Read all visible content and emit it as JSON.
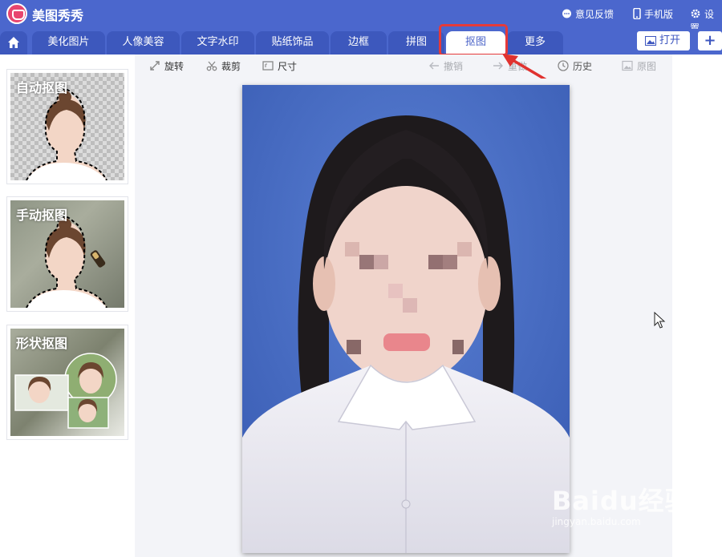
{
  "app": {
    "name": "美图秀秀"
  },
  "titlebar": {
    "feedback": "意见反馈",
    "mobile": "手机版",
    "settings": "设置"
  },
  "tabs": [
    {
      "label": "美化图片"
    },
    {
      "label": "人像美容"
    },
    {
      "label": "文字水印"
    },
    {
      "label": "贴纸饰品"
    },
    {
      "label": "边框"
    },
    {
      "label": "拼图"
    },
    {
      "label": "抠图",
      "active": true
    },
    {
      "label": "更多"
    }
  ],
  "tabbar_buttons": {
    "open": "打开",
    "add": "+"
  },
  "cutout_modes": [
    {
      "label": "自动抠图"
    },
    {
      "label": "手动抠图"
    },
    {
      "label": "形状抠图"
    }
  ],
  "toolbar": {
    "rotate": "旋转",
    "crop": "裁剪",
    "size": "尺寸",
    "undo": "撤销",
    "redo": "重做",
    "history": "历史",
    "original": "原图"
  },
  "watermark": {
    "main": "Baidu经验",
    "sub": "jingyan.baidu.com"
  },
  "colors": {
    "brand": "#4b67cd",
    "highlight": "#e53a3a",
    "photo_bg": "#4a6ec3"
  }
}
